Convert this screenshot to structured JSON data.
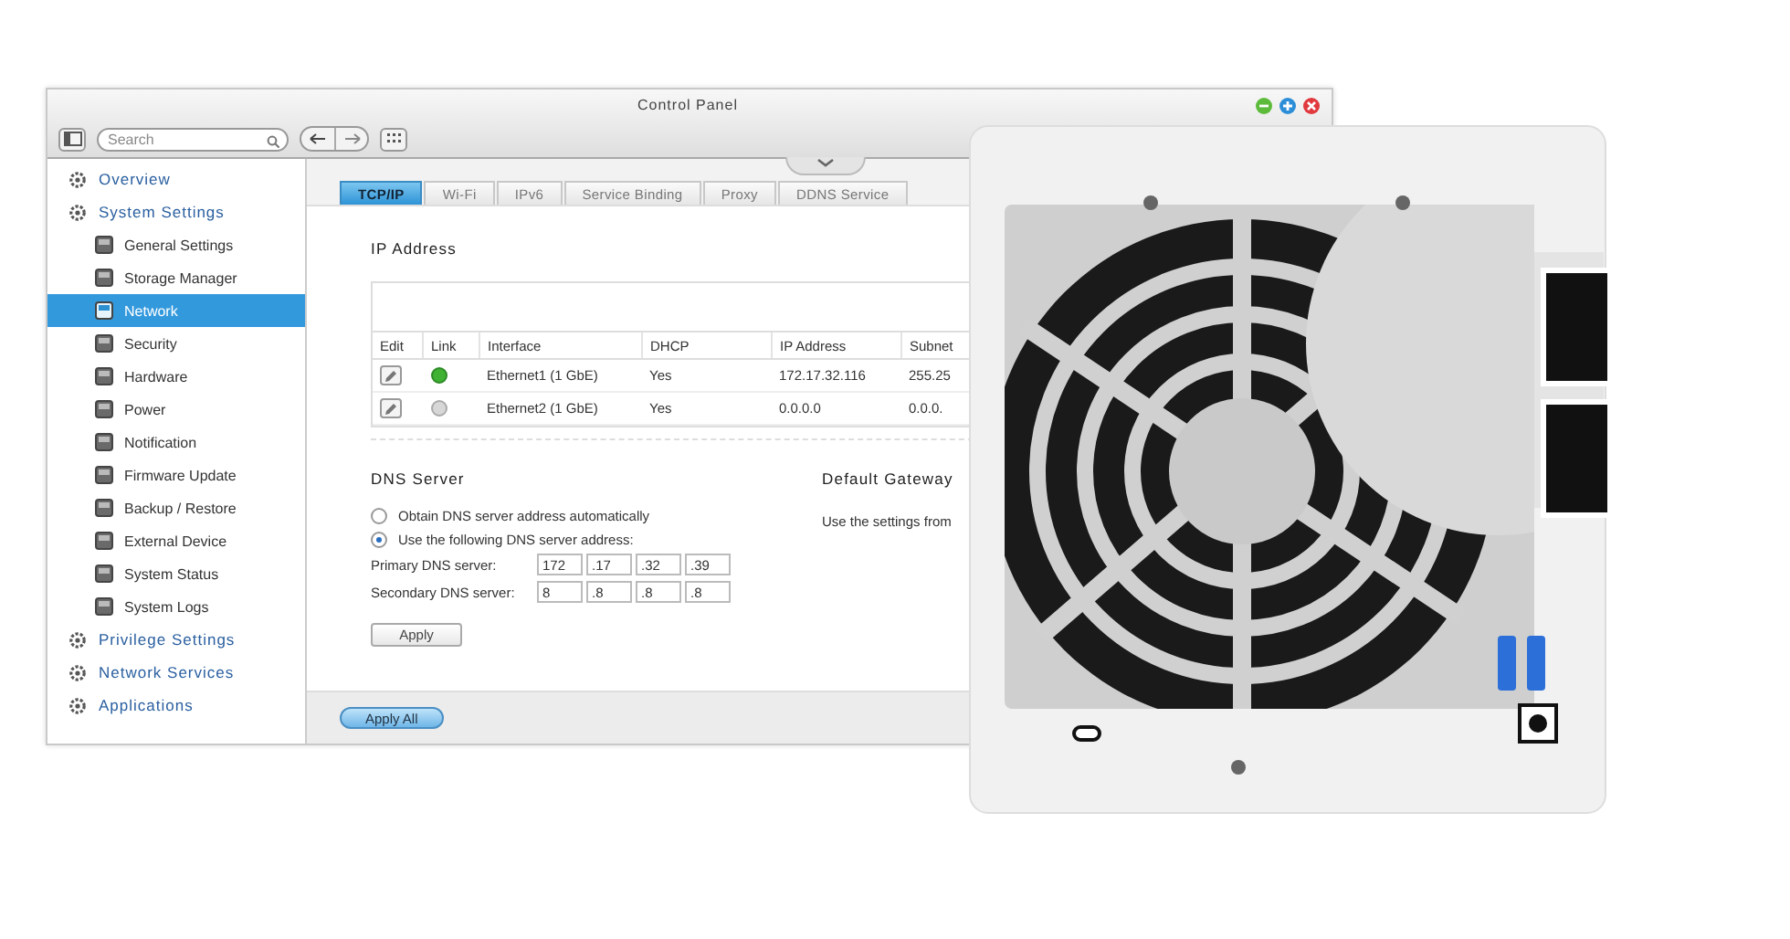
{
  "window": {
    "title": "Control Panel"
  },
  "toolbar": {
    "search": {
      "placeholder": "Search"
    }
  },
  "sidebar": {
    "items": [
      {
        "label": "Overview",
        "selected": false
      },
      {
        "label": "System Settings",
        "selected": false,
        "children": [
          {
            "label": "General Settings",
            "selected": false
          },
          {
            "label": "Storage Manager",
            "selected": false
          },
          {
            "label": "Network",
            "selected": true
          },
          {
            "label": "Security",
            "selected": false
          },
          {
            "label": "Hardware",
            "selected": false
          },
          {
            "label": "Power",
            "selected": false
          },
          {
            "label": "Notification",
            "selected": false
          },
          {
            "label": "Firmware Update",
            "selected": false
          },
          {
            "label": "Backup / Restore",
            "selected": false
          },
          {
            "label": "External Device",
            "selected": false
          },
          {
            "label": "System Status",
            "selected": false
          },
          {
            "label": "System Logs",
            "selected": false
          }
        ]
      },
      {
        "label": "Privilege Settings",
        "selected": false
      },
      {
        "label": "Network Services",
        "selected": false
      },
      {
        "label": "Applications",
        "selected": false
      }
    ]
  },
  "tabs": [
    {
      "label": "TCP/IP",
      "selected": true
    },
    {
      "label": "Wi-Fi",
      "selected": false
    },
    {
      "label": "IPv6",
      "selected": false
    },
    {
      "label": "Service Binding",
      "selected": false
    },
    {
      "label": "Proxy",
      "selected": false
    },
    {
      "label": "DDNS Service",
      "selected": false
    }
  ],
  "ip_address": {
    "heading": "IP Address",
    "table": {
      "columns": [
        "Edit",
        "Link",
        "Interface",
        "DHCP",
        "IP Address",
        "Subnet"
      ],
      "rows": [
        {
          "link": true,
          "cells": [
            "",
            "",
            "Ethernet1 (1 GbE)",
            "Yes",
            "172.17.32.116",
            "255.25"
          ]
        },
        {
          "link": false,
          "cells": [
            "",
            "",
            "Ethernet2 (1 GbE)",
            "Yes",
            "0.0.0.0",
            "0.0.0."
          ]
        }
      ]
    }
  },
  "dns": {
    "heading": "DNS Server",
    "options": [
      {
        "label": "Obtain DNS server address automatically",
        "selected": false
      },
      {
        "label": "Use the following DNS server address:",
        "selected": true
      }
    ],
    "fields": [
      {
        "label": "Primary DNS server:",
        "values": [
          "172",
          ".17",
          ".32",
          ".39"
        ]
      },
      {
        "label": "Secondary DNS server:",
        "values": [
          "8",
          ".8",
          ".8",
          ".8"
        ]
      }
    ],
    "apply": "Apply"
  },
  "default_gateway": {
    "heading": "Default Gateway",
    "text": "Use the settings from"
  },
  "footer": {
    "apply_all": "Apply All"
  }
}
